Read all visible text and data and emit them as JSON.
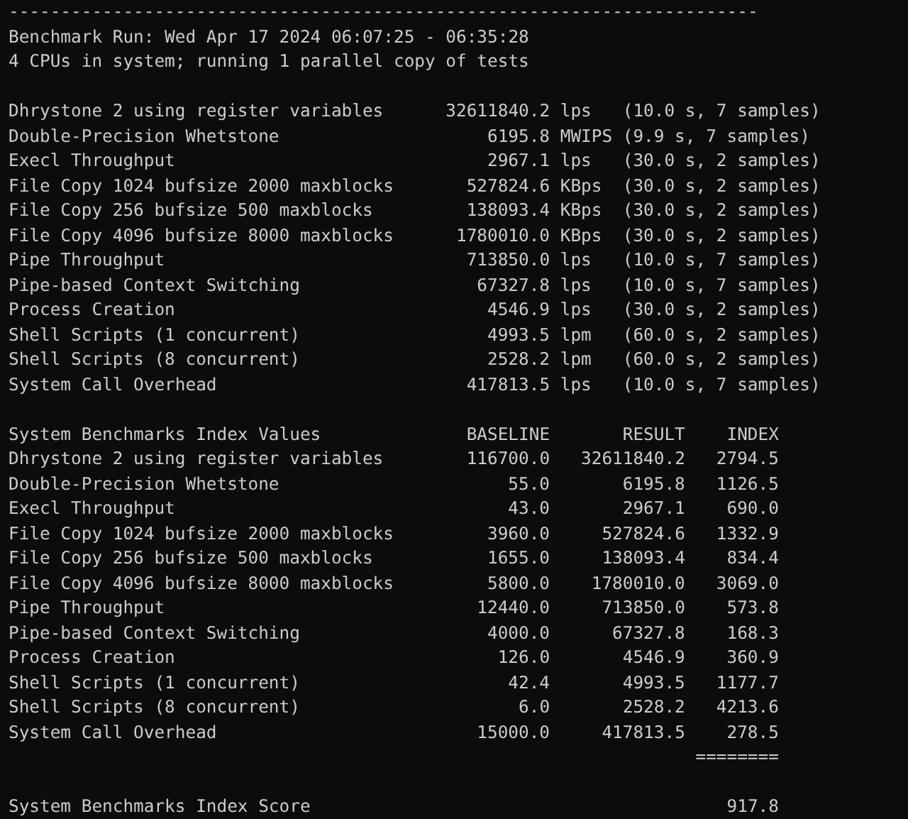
{
  "terminal": {
    "separator": "------------------------------------------------------------------------",
    "header": [
      "Benchmark Run: Wed Apr 17 2024 06:07:25 - 06:35:28",
      "4 CPUs in system; running 1 parallel copy of tests"
    ],
    "benchmarks": [
      {
        "name": "Dhrystone 2 using register variables",
        "value": "32611840.2",
        "unit": "lps",
        "timing": "(10.0 s, 7 samples)"
      },
      {
        "name": "Double-Precision Whetstone",
        "value": "6195.8",
        "unit": "MWIPS",
        "timing": "(9.9 s, 7 samples)"
      },
      {
        "name": "Execl Throughput",
        "value": "2967.1",
        "unit": "lps",
        "timing": "(30.0 s, 2 samples)"
      },
      {
        "name": "File Copy 1024 bufsize 2000 maxblocks",
        "value": "527824.6",
        "unit": "KBps",
        "timing": "(30.0 s, 2 samples)"
      },
      {
        "name": "File Copy 256 bufsize 500 maxblocks",
        "value": "138093.4",
        "unit": "KBps",
        "timing": "(30.0 s, 2 samples)"
      },
      {
        "name": "File Copy 4096 bufsize 8000 maxblocks",
        "value": "1780010.0",
        "unit": "KBps",
        "timing": "(30.0 s, 2 samples)"
      },
      {
        "name": "Pipe Throughput",
        "value": "713850.0",
        "unit": "lps",
        "timing": "(10.0 s, 7 samples)"
      },
      {
        "name": "Pipe-based Context Switching",
        "value": "67327.8",
        "unit": "lps",
        "timing": "(10.0 s, 7 samples)"
      },
      {
        "name": "Process Creation",
        "value": "4546.9",
        "unit": "lps",
        "timing": "(30.0 s, 2 samples)"
      },
      {
        "name": "Shell Scripts (1 concurrent)",
        "value": "4993.5",
        "unit": "lpm",
        "timing": "(60.0 s, 2 samples)"
      },
      {
        "name": "Shell Scripts (8 concurrent)",
        "value": "2528.2",
        "unit": "lpm",
        "timing": "(60.0 s, 2 samples)"
      },
      {
        "name": "System Call Overhead",
        "value": "417813.5",
        "unit": "lps",
        "timing": "(10.0 s, 7 samples)"
      }
    ],
    "index_table": {
      "title": "System Benchmarks Index Values",
      "columns": [
        "BASELINE",
        "RESULT",
        "INDEX"
      ],
      "rows": [
        {
          "name": "Dhrystone 2 using register variables",
          "baseline": "116700.0",
          "result": "32611840.2",
          "index": "2794.5"
        },
        {
          "name": "Double-Precision Whetstone",
          "baseline": "55.0",
          "result": "6195.8",
          "index": "1126.5"
        },
        {
          "name": "Execl Throughput",
          "baseline": "43.0",
          "result": "2967.1",
          "index": "690.0"
        },
        {
          "name": "File Copy 1024 bufsize 2000 maxblocks",
          "baseline": "3960.0",
          "result": "527824.6",
          "index": "1332.9"
        },
        {
          "name": "File Copy 256 bufsize 500 maxblocks",
          "baseline": "1655.0",
          "result": "138093.4",
          "index": "834.4"
        },
        {
          "name": "File Copy 4096 bufsize 8000 maxblocks",
          "baseline": "5800.0",
          "result": "1780010.0",
          "index": "3069.0"
        },
        {
          "name": "Pipe Throughput",
          "baseline": "12440.0",
          "result": "713850.0",
          "index": "573.8"
        },
        {
          "name": "Pipe-based Context Switching",
          "baseline": "4000.0",
          "result": "67327.8",
          "index": "168.3"
        },
        {
          "name": "Process Creation",
          "baseline": "126.0",
          "result": "4546.9",
          "index": "360.9"
        },
        {
          "name": "Shell Scripts (1 concurrent)",
          "baseline": "42.4",
          "result": "4993.5",
          "index": "1177.7"
        },
        {
          "name": "Shell Scripts (8 concurrent)",
          "baseline": "6.0",
          "result": "2528.2",
          "index": "4213.6"
        },
        {
          "name": "System Call Overhead",
          "baseline": "15000.0",
          "result": "417813.5",
          "index": "278.5"
        }
      ],
      "total_rule": "========",
      "score_label": "System Benchmarks Index Score",
      "score": "917.8"
    }
  }
}
